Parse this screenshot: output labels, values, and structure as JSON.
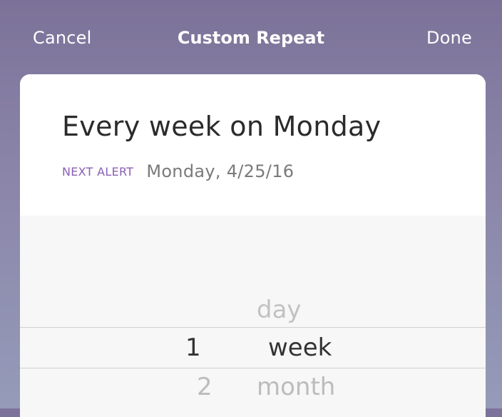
{
  "nav": {
    "cancel_label": "Cancel",
    "title": "Custom Repeat",
    "done_label": "Done"
  },
  "summary": {
    "title": "Every week on Monday",
    "next_alert_label": "NEXT ALERT",
    "next_alert_date": "Monday, 4/25/16"
  },
  "picker": {
    "number_column": {
      "selected": "1",
      "below": "2"
    },
    "unit_column": {
      "above": "day",
      "selected": "week",
      "below": "month"
    }
  },
  "colors": {
    "accent": "#8a5fb4",
    "header_gradient_top": "#7c7299",
    "header_gradient_bottom": "#959bb9"
  }
}
